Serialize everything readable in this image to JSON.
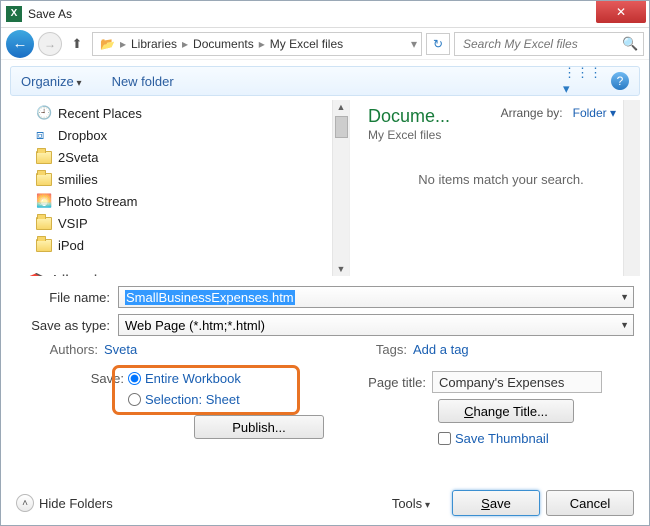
{
  "titlebar": {
    "title": "Save As"
  },
  "breadcrumb": {
    "parts": [
      "Libraries",
      "Documents",
      "My Excel files"
    ]
  },
  "search": {
    "placeholder": "Search My Excel files"
  },
  "toolbar": {
    "organize": "Organize",
    "newfolder": "New folder"
  },
  "tree": {
    "items": [
      {
        "name": "Recent Places",
        "icon": "recent"
      },
      {
        "name": "Dropbox",
        "icon": "dropbox"
      },
      {
        "name": "2Sveta",
        "icon": "folder"
      },
      {
        "name": "smilies",
        "icon": "folder"
      },
      {
        "name": "Photo Stream",
        "icon": "photo"
      },
      {
        "name": "VSIP",
        "icon": "folder"
      },
      {
        "name": "iPod",
        "icon": "folder"
      }
    ],
    "libraries": "Libraries"
  },
  "content": {
    "heading": "Docume...",
    "subpath": "My Excel files",
    "arrange_label": "Arrange by:",
    "arrange_value": "Folder",
    "empty": "No items match your search."
  },
  "filename": {
    "label": "File name:",
    "value": "SmallBusinessExpenses.htm"
  },
  "saveastype": {
    "label": "Save as type:",
    "value": "Web Page (*.htm;*.html)"
  },
  "authors": {
    "label": "Authors:",
    "value": "Sveta"
  },
  "tags": {
    "label": "Tags:",
    "value": "Add a tag"
  },
  "save_radio": {
    "label": "Save:",
    "entire": "Entire Workbook",
    "selection": "Selection: Sheet"
  },
  "publish": "Publish...",
  "page_title": {
    "label": "Page title:",
    "value": "Company's Expenses"
  },
  "change_title": "Change Title...",
  "save_thumbnail": "Save Thumbnail",
  "footer": {
    "hide": "Hide Folders",
    "tools": "Tools",
    "save": "Save",
    "cancel": "Cancel"
  }
}
